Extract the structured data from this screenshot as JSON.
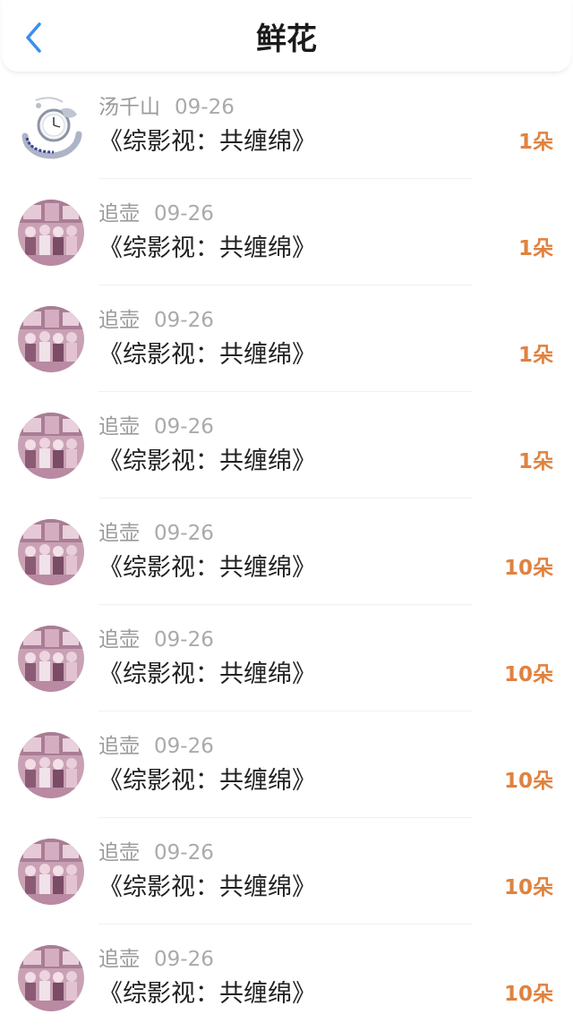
{
  "header": {
    "title": "鲜花",
    "back_icon": "chevron-left-icon",
    "accent_color": "#3a8df0"
  },
  "rows": [
    {
      "user": "汤千山",
      "date": "09-26",
      "book": "《综影视：共缠绵》",
      "amount": "1朵",
      "avatar": "watch-pendant"
    },
    {
      "user": "追壶",
      "date": "09-26",
      "book": "《综影视：共缠绵》",
      "amount": "1朵",
      "avatar": "group-photo-pink"
    },
    {
      "user": "追壶",
      "date": "09-26",
      "book": "《综影视：共缠绵》",
      "amount": "1朵",
      "avatar": "group-photo-pink"
    },
    {
      "user": "追壶",
      "date": "09-26",
      "book": "《综影视：共缠绵》",
      "amount": "1朵",
      "avatar": "group-photo-pink"
    },
    {
      "user": "追壶",
      "date": "09-26",
      "book": "《综影视：共缠绵》",
      "amount": "10朵",
      "avatar": "group-photo-pink"
    },
    {
      "user": "追壶",
      "date": "09-26",
      "book": "《综影视：共缠绵》",
      "amount": "10朵",
      "avatar": "group-photo-pink"
    },
    {
      "user": "追壶",
      "date": "09-26",
      "book": "《综影视：共缠绵》",
      "amount": "10朵",
      "avatar": "group-photo-pink"
    },
    {
      "user": "追壶",
      "date": "09-26",
      "book": "《综影视：共缠绵》",
      "amount": "10朵",
      "avatar": "group-photo-pink"
    },
    {
      "user": "追壶",
      "date": "09-26",
      "book": "《综影视：共缠绵》",
      "amount": "10朵",
      "avatar": "group-photo-pink"
    }
  ],
  "colors": {
    "amount": "#e0823f",
    "username": "#9b9b9b",
    "book_title": "#222222"
  }
}
